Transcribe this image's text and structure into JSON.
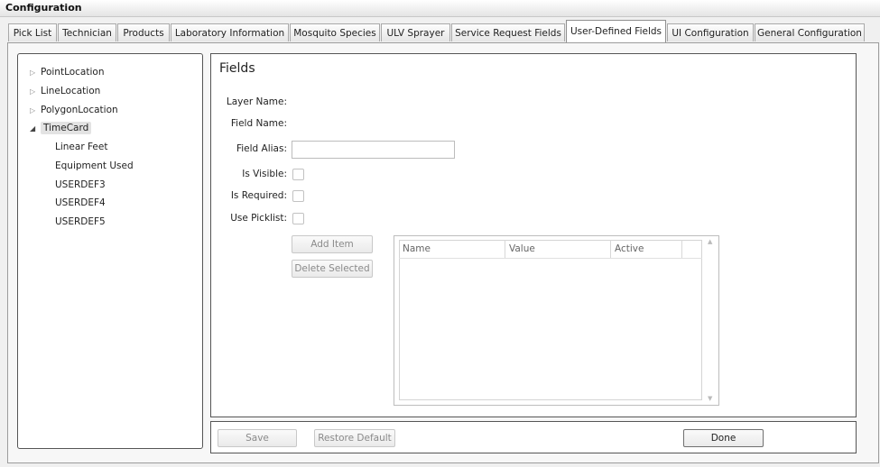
{
  "window": {
    "title": "Configuration"
  },
  "tabs": [
    {
      "label": "Pick List"
    },
    {
      "label": "Technician"
    },
    {
      "label": "Products"
    },
    {
      "label": "Laboratory Information"
    },
    {
      "label": "Mosquito Species"
    },
    {
      "label": "ULV Sprayer"
    },
    {
      "label": "Service Request Fields"
    },
    {
      "label": "User-Defined Fields",
      "active": true
    },
    {
      "label": "UI Configuration"
    },
    {
      "label": "General Configuration"
    }
  ],
  "tree": {
    "nodes": [
      {
        "label": "PointLocation",
        "expanded": false
      },
      {
        "label": "LineLocation",
        "expanded": false
      },
      {
        "label": "PolygonLocation",
        "expanded": false
      },
      {
        "label": "TimeCard",
        "expanded": true,
        "selected": true,
        "children": [
          "Linear Feet",
          "Equipment Used",
          "USERDEF3",
          "USERDEF4",
          "USERDEF5"
        ]
      }
    ]
  },
  "fields": {
    "title": "Fields",
    "layer_name_label": "Layer Name:",
    "field_name_label": "Field Name:",
    "field_alias_label": "Field Alias:",
    "field_alias_value": "",
    "is_visible_label": "Is Visible:",
    "is_required_label": "Is Required:",
    "use_picklist_label": "Use Picklist:",
    "is_visible": false,
    "is_required": false,
    "use_picklist": false,
    "add_item_label": "Add Item",
    "delete_selected_label": "Delete Selected"
  },
  "picklist_grid": {
    "columns": [
      "Name",
      "Value",
      "Active"
    ],
    "rows": []
  },
  "footer": {
    "save_label": "Save",
    "restore_default_label": "Restore Default",
    "done_label": "Done"
  },
  "icons": {
    "collapsed": "triangle-right-icon",
    "expanded": "triangle-down-icon"
  }
}
